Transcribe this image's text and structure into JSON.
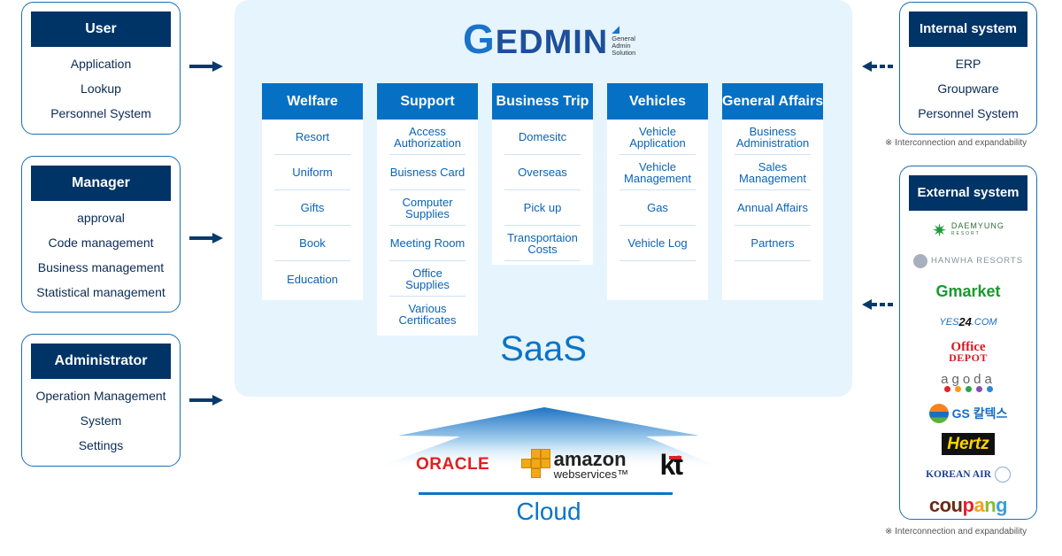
{
  "roles": [
    {
      "title": "User",
      "items": [
        "Application",
        "Lookup",
        "Personnel System"
      ]
    },
    {
      "title": "Manager",
      "items": [
        "approval",
        "Code management",
        "Business management",
        "Statistical management"
      ]
    },
    {
      "title": "Administrator",
      "items": [
        "Operation Management",
        "System",
        "Settings"
      ]
    }
  ],
  "logo": {
    "brand_first": "G",
    "brand_rest": "EDMIN",
    "tag_lines": [
      "General",
      "Admin",
      "Solution"
    ]
  },
  "modules": [
    {
      "title": "Welfare",
      "items": [
        "Resort",
        "Uniform",
        "Gifts",
        "Book",
        "Education"
      ]
    },
    {
      "title": "Support",
      "items": [
        "Access\nAuthorization",
        "Buisness Card",
        "Computer\nSupplies",
        "Meeting Room",
        "Office Supplies",
        "Various\nCertificates"
      ]
    },
    {
      "title": "Business Trip",
      "items": [
        "Domesitc",
        "Overseas",
        "Pick up",
        "Transportaion\nCosts"
      ]
    },
    {
      "title": "Vehicles",
      "items": [
        "Vehicle\nApplication",
        "Vehicle\nManagement",
        "Gas",
        "Vehicle Log"
      ]
    },
    {
      "title": "General Affairs",
      "items": [
        "Business\nAdministration",
        "Sales\nManagement",
        "Annual Affairs",
        "Partners"
      ]
    }
  ],
  "saas_label": "SaaS",
  "cloud": {
    "label": "Cloud",
    "providers": {
      "oracle": "ORACLE",
      "aws_line1": "amazon",
      "aws_line2": "webservices™",
      "kt": "kt"
    }
  },
  "internal_system": {
    "title": "Internal system",
    "items": [
      "ERP",
      "Groupware",
      "Personnel System"
    ]
  },
  "external_system": {
    "title": "External system",
    "partners": {
      "daemyung": "DAEMYUNG",
      "daemyung_sub": "RESORT",
      "hanwha": "HANWHA RESORTS",
      "gmarket": "Gmarket",
      "yes24_a": "YES",
      "yes24_b": "24",
      "yes24_c": ".COM",
      "office1": "Office",
      "office2": "DEPOT",
      "agoda": "agoda",
      "gs": "GS 칼텍스",
      "hertz": "Hertz",
      "korean_air": "KOREAN AIR",
      "coupang": "coupang"
    }
  },
  "notes": {
    "interconnection": "※ Interconnection and expandability"
  },
  "colors": {
    "navy": "#003366",
    "module_blue": "#0670c5",
    "panel_bg": "#e6f4fd",
    "accent": "#0b74c6"
  }
}
